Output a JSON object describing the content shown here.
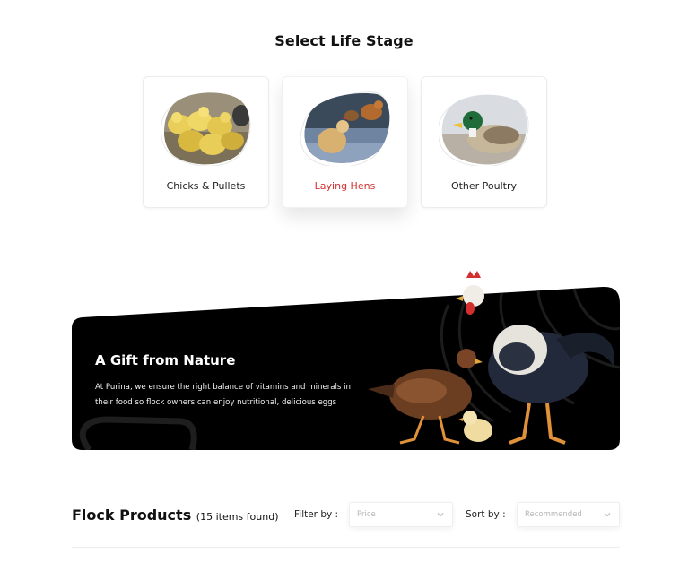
{
  "life_stage": {
    "title": "Select Life Stage",
    "cards": [
      {
        "label": "Chicks & Pullets",
        "active": false,
        "image": "chicks-photo"
      },
      {
        "label": "Laying Hens",
        "active": true,
        "image": "hens-photo"
      },
      {
        "label": "Other Poultry",
        "active": false,
        "image": "duck-photo"
      }
    ]
  },
  "banner": {
    "title": "A Gift from Nature",
    "text": "At Purina, we ensure the right balance of vitamins and minerals in their food so flock owners can enjoy nutritional, delicious eggs",
    "image": "rooster-hen-chick-illustration"
  },
  "products": {
    "title": "Flock Products",
    "count": "(15 items found)",
    "filter_label": "Filter by :",
    "filter_value": "Price",
    "sort_label": "Sort by :",
    "sort_value": "Recommended"
  },
  "colors": {
    "accent": "#d32f2f",
    "banner_bg": "#000000"
  }
}
